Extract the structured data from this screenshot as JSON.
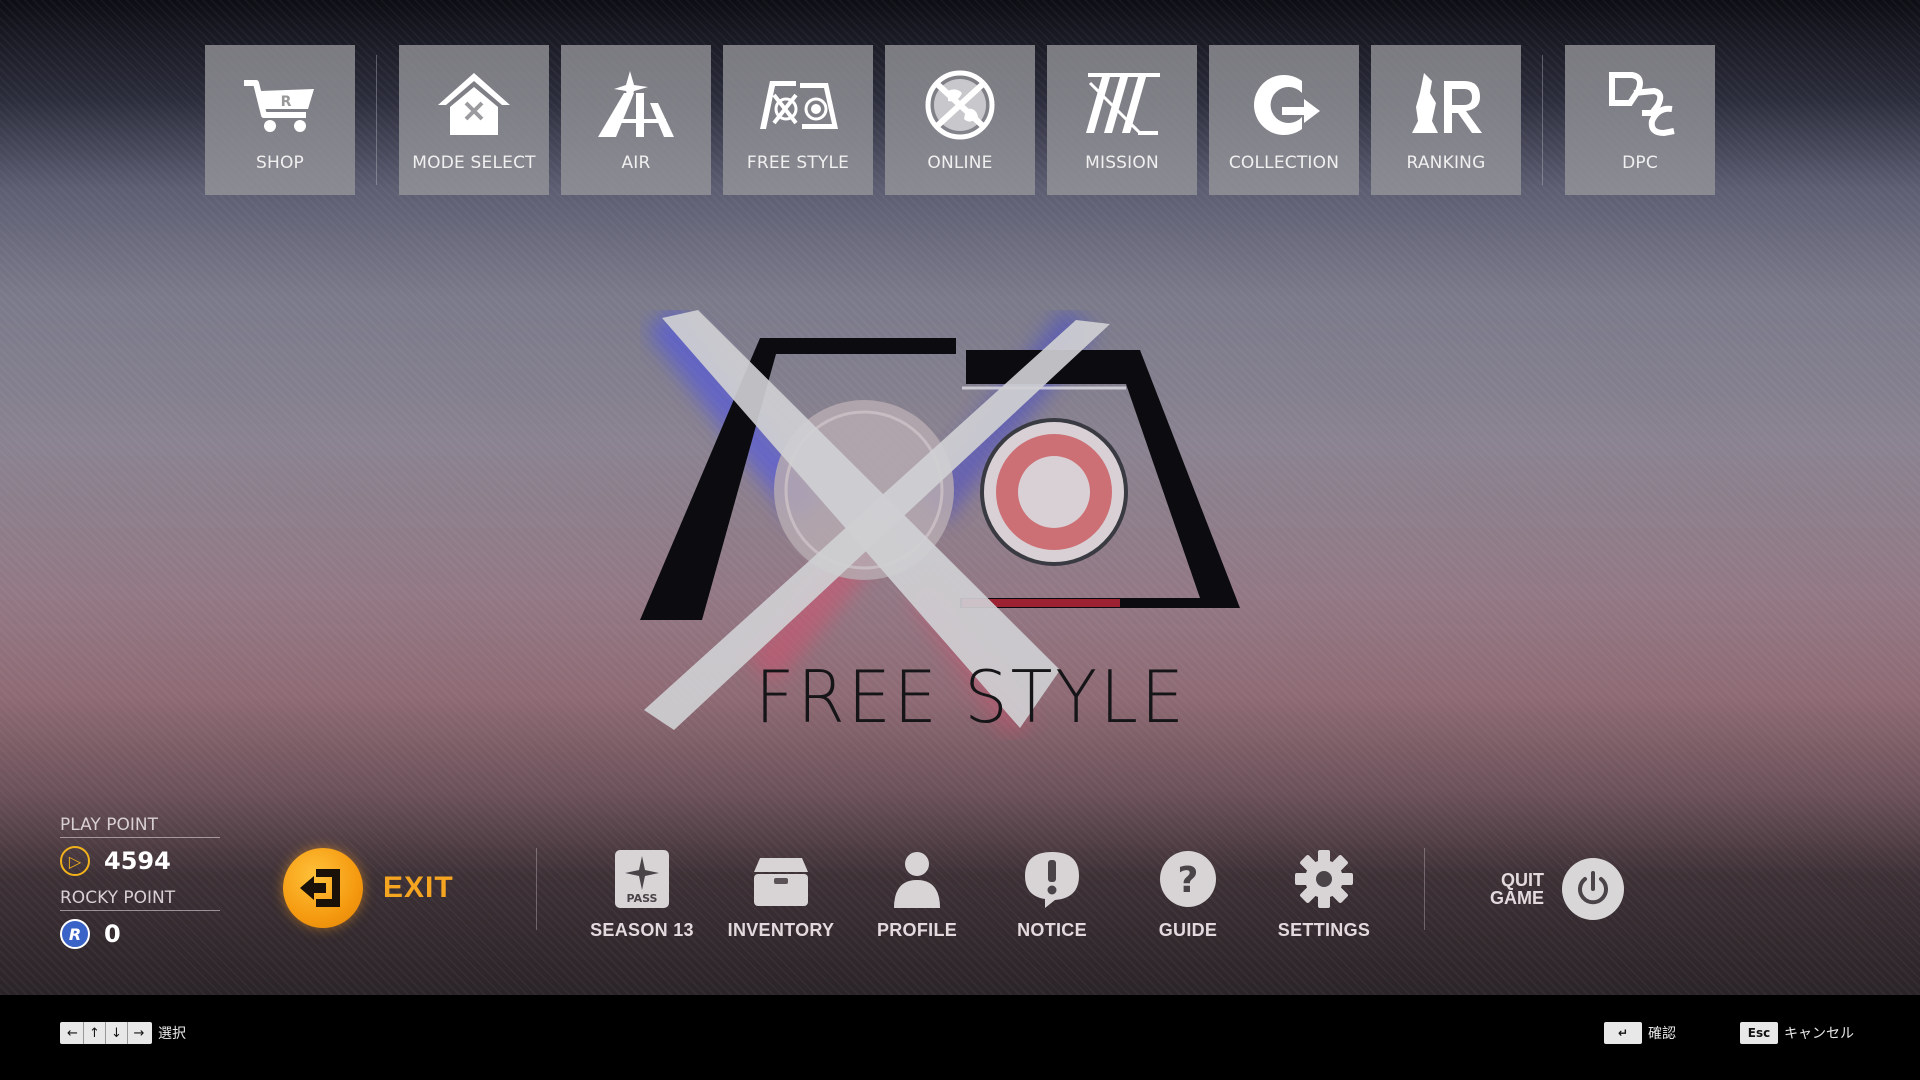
{
  "top_menu": {
    "items": [
      {
        "label": "SHOP",
        "icon": "shop-cart-icon"
      },
      {
        "label": "MODE SELECT",
        "icon": "home-icon"
      },
      {
        "label": "AIR",
        "icon": "air-icon"
      },
      {
        "label": "FREE STYLE",
        "icon": "free-style-icon"
      },
      {
        "label": "ONLINE",
        "icon": "globe-icon"
      },
      {
        "label": "MISSION",
        "icon": "mission-icon"
      },
      {
        "label": "COLLECTION",
        "icon": "collection-icon"
      },
      {
        "label": "RANKING",
        "icon": "ranking-icon"
      },
      {
        "label": "DPC",
        "icon": "dpc-icon"
      }
    ]
  },
  "hero": {
    "title": "FREE STYLE"
  },
  "points": {
    "play_label": "PLAY POINT",
    "play_value": "4594",
    "play_icon_glyph": "▷",
    "rocky_label": "ROCKY POINT",
    "rocky_value": "0",
    "rocky_icon_glyph": "R"
  },
  "exit": {
    "label": "EXIT"
  },
  "bottom_menu": {
    "items": [
      {
        "label": "SEASON 13",
        "icon": "season-pass-icon",
        "icon_text": "PASS"
      },
      {
        "label": "INVENTORY",
        "icon": "inventory-box-icon"
      },
      {
        "label": "PROFILE",
        "icon": "profile-person-icon"
      },
      {
        "label": "NOTICE",
        "icon": "notice-bubble-icon"
      },
      {
        "label": "GUIDE",
        "icon": "guide-question-icon"
      },
      {
        "label": "SETTINGS",
        "icon": "settings-gear-icon"
      }
    ]
  },
  "quit": {
    "label_line1": "QUIT",
    "label_line2": "GAME"
  },
  "footer": {
    "select_keys": [
      "←",
      "↑",
      "↓",
      "→"
    ],
    "select_text": "選択",
    "confirm_key": "↵",
    "confirm_text": "確認",
    "cancel_key": "Esc",
    "cancel_text": "キャンセル"
  },
  "colors": {
    "tile_bg": "#96969b",
    "exit_orange": "#f6a521",
    "play_point_yellow": "#f2b21b",
    "rocky_point_blue": "#3a63c8"
  }
}
